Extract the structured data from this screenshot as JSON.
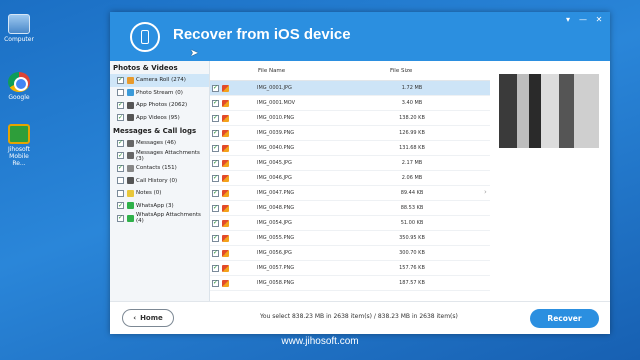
{
  "desktop": {
    "icons": [
      {
        "label": "Computer",
        "icon": "computer-icon"
      },
      {
        "label": "Google Chrome",
        "icon": "chrome-icon"
      },
      {
        "label": "Jihosoft Mobile Re...",
        "icon": "jihosoft-icon"
      }
    ],
    "computer_label": "Computer",
    "chrome_label": "Google",
    "jiho_line1": "Jihosoft",
    "jiho_line2": "Mobile Re..."
  },
  "window": {
    "title": "Recover from iOS device",
    "icon": "phone-icon",
    "controls": [
      "▾",
      "—",
      "✕"
    ]
  },
  "sidebar": {
    "sections": [
      {
        "title": "Photos & Videos",
        "items": [
          {
            "label": "Camera Roll (274)",
            "checked": true,
            "selected": true,
            "icon_color": "#e89a2c"
          },
          {
            "label": "Photo Stream (0)",
            "checked": false,
            "selected": false,
            "icon_color": "#3a9ad9"
          },
          {
            "label": "App Photos (2062)",
            "checked": true,
            "selected": false,
            "icon_color": "#555555"
          },
          {
            "label": "App Videos (95)",
            "checked": true,
            "selected": false,
            "icon_color": "#555555"
          }
        ]
      },
      {
        "title": "Messages & Call logs",
        "items": [
          {
            "label": "Messages (46)",
            "checked": true,
            "selected": false,
            "icon_color": "#666666"
          },
          {
            "label": "Messages Attachments (3)",
            "checked": true,
            "selected": false,
            "icon_color": "#666666"
          },
          {
            "label": "Contacts (151)",
            "checked": true,
            "selected": false,
            "icon_color": "#888888"
          },
          {
            "label": "Call History (0)",
            "checked": false,
            "selected": false,
            "icon_color": "#555555"
          },
          {
            "label": "Notes (0)",
            "checked": false,
            "selected": false,
            "icon_color": "#e8c73a"
          },
          {
            "label": "WhatsApp (3)",
            "checked": true,
            "selected": false,
            "icon_color": "#2fb14a"
          },
          {
            "label": "WhatsApp Attachments (4)",
            "checked": true,
            "selected": false,
            "icon_color": "#2fb14a"
          }
        ]
      }
    ]
  },
  "table": {
    "headers": {
      "name": "File Name",
      "size": "File Size"
    },
    "rows": [
      {
        "name": "IMG_0001.JPG",
        "size": "1.72 MB",
        "selected": true
      },
      {
        "name": "IMG_0001.MOV",
        "size": "3.40 MB",
        "selected": false
      },
      {
        "name": "IMG_0010.PNG",
        "size": "138.20 KB",
        "selected": false
      },
      {
        "name": "IMG_0039.PNG",
        "size": "126.99 KB",
        "selected": false
      },
      {
        "name": "IMG_0040.PNG",
        "size": "131.68 KB",
        "selected": false
      },
      {
        "name": "IMG_0045.JPG",
        "size": "2.17 MB",
        "selected": false
      },
      {
        "name": "IMG_0046.JPG",
        "size": "2.06 MB",
        "selected": false
      },
      {
        "name": "IMG_0047.PNG",
        "size": "89.44 KB",
        "selected": false
      },
      {
        "name": "IMG_0048.PNG",
        "size": "88.53 KB",
        "selected": false
      },
      {
        "name": "IMG_0054.JPG",
        "size": "51.00 KB",
        "selected": false
      },
      {
        "name": "IMG_0055.PNG",
        "size": "350.95 KB",
        "selected": false
      },
      {
        "name": "IMG_0056.JPG",
        "size": "300.70 KB",
        "selected": false
      },
      {
        "name": "IMG_0057.PNG",
        "size": "157.76 KB",
        "selected": false
      },
      {
        "name": "IMG_0058.PNG",
        "size": "187.57 KB",
        "selected": false
      }
    ]
  },
  "footer": {
    "home_label": "Home",
    "home_icon": "chevron-left-icon",
    "status": "You select 838.23 MB in 2638 item(s) / 838.23 MB in 2638 item(s)",
    "recover_label": "Recover"
  },
  "watermark": "www.jihosoft.com",
  "colors": {
    "accent": "#2b8fe0",
    "selected_row": "#cde4f7",
    "check": "#1d8a2a"
  }
}
